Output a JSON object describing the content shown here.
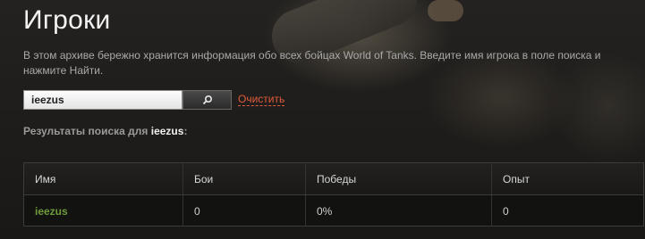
{
  "page": {
    "title": "Игроки",
    "intro": "В этом архиве бережно хранится информация обо всех бойцах World of Tanks. Введите имя игрока в поле поиска и нажмите Найти."
  },
  "search": {
    "value": "ieezus",
    "button_icon": "search-icon",
    "clear_label": "Очистить"
  },
  "results": {
    "label": "Результаты поиска для",
    "query": "ieezus",
    "suffix": ":"
  },
  "table": {
    "headers": [
      "Имя",
      "Бои",
      "Победы",
      "Опыт"
    ],
    "rows": [
      {
        "name": "ieezus",
        "battles": "0",
        "wins": "0%",
        "experience": "0"
      }
    ]
  },
  "colors": {
    "accent_link": "#e05a3a",
    "player_name": "#6e9a3a",
    "background": "#1b1a19"
  }
}
